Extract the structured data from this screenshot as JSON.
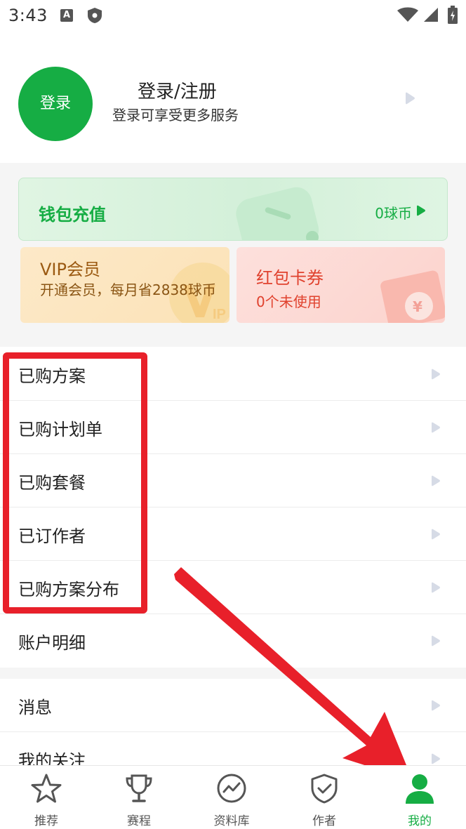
{
  "status_bar": {
    "time": "3:43",
    "a_badge": "A"
  },
  "profile": {
    "avatar_label": "登录",
    "title": "登录/注册",
    "subtitle": "登录可享受更多服务"
  },
  "wallet": {
    "title": "钱包充值",
    "balance": "0球币"
  },
  "vip": {
    "title": "VIP会员",
    "subtitle": "开通会员，每月省2838球币"
  },
  "red_packet": {
    "title": "红包卡券",
    "subtitle": "0个未使用"
  },
  "menu_group1": [
    {
      "label": "已购方案"
    },
    {
      "label": "已购计划单"
    },
    {
      "label": "已购套餐"
    },
    {
      "label": "已订作者"
    },
    {
      "label": "已购方案分布"
    },
    {
      "label": "账户明细"
    }
  ],
  "menu_group2": [
    {
      "label": "消息"
    },
    {
      "label": "我的关注"
    }
  ],
  "tabs": [
    {
      "label": "推荐",
      "icon": "star-icon"
    },
    {
      "label": "赛程",
      "icon": "trophy-icon"
    },
    {
      "label": "资料库",
      "icon": "chart-circle-icon"
    },
    {
      "label": "作者",
      "icon": "shield-check-icon"
    },
    {
      "label": "我的",
      "icon": "person-icon",
      "active": true
    }
  ],
  "colors": {
    "brand_green": "#16ad44",
    "vip_brown": "#9b5a12",
    "red_packet": "#e0412d",
    "annotation_red": "#e8202a"
  }
}
